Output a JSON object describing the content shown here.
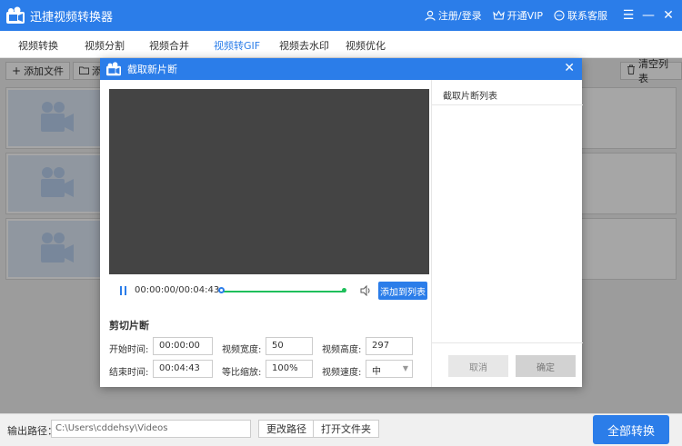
{
  "app": {
    "title": "迅捷视频转换器"
  },
  "title_actions": {
    "login": "注册/登录",
    "vip": "开通VIP",
    "support": "联系客服"
  },
  "window_controls": {
    "menu": "☰",
    "minimize": "—",
    "close": "✕"
  },
  "tabs": [
    {
      "label": "视频转换",
      "active": false
    },
    {
      "label": "视频分割",
      "active": false
    },
    {
      "label": "视频合并",
      "active": false
    },
    {
      "label": "视频转GIF",
      "active": true
    },
    {
      "label": "视频去水印",
      "active": false
    },
    {
      "label": "视频优化",
      "active": false
    }
  ],
  "toolbar": {
    "add_file": "添加文件",
    "add_folder": "添",
    "clear_list": "清空列表"
  },
  "bottom": {
    "output_label": "输出路径：",
    "output_path": "C:\\Users\\cddehsy\\Videos",
    "change_path": "更改路径",
    "open_folder": "打开文件夹",
    "convert_all": "全部转换"
  },
  "dialog": {
    "title": "截取新片断",
    "close": "✕",
    "player": {
      "time": "00:00:00/00:04:43",
      "add_to_list": "添加到列表"
    },
    "section_title": "剪切片断",
    "fields": {
      "start_label": "开始时间:",
      "start_value": "00:00:00",
      "end_label": "结束时间:",
      "end_value": "00:04:43",
      "width_label": "视频宽度:",
      "width_value": "50",
      "scale_label": "等比缩放:",
      "scale_value": "100%",
      "height_label": "视频高度:",
      "height_value": "297",
      "speed_label": "视频速度:",
      "speed_value": "中"
    },
    "right_panel": {
      "title": "截取片断列表",
      "cancel": "取消",
      "ok": "确定"
    }
  },
  "colors": {
    "accent": "#2b7de9",
    "timeline": "#1fbf5b",
    "preview": "#444444"
  }
}
